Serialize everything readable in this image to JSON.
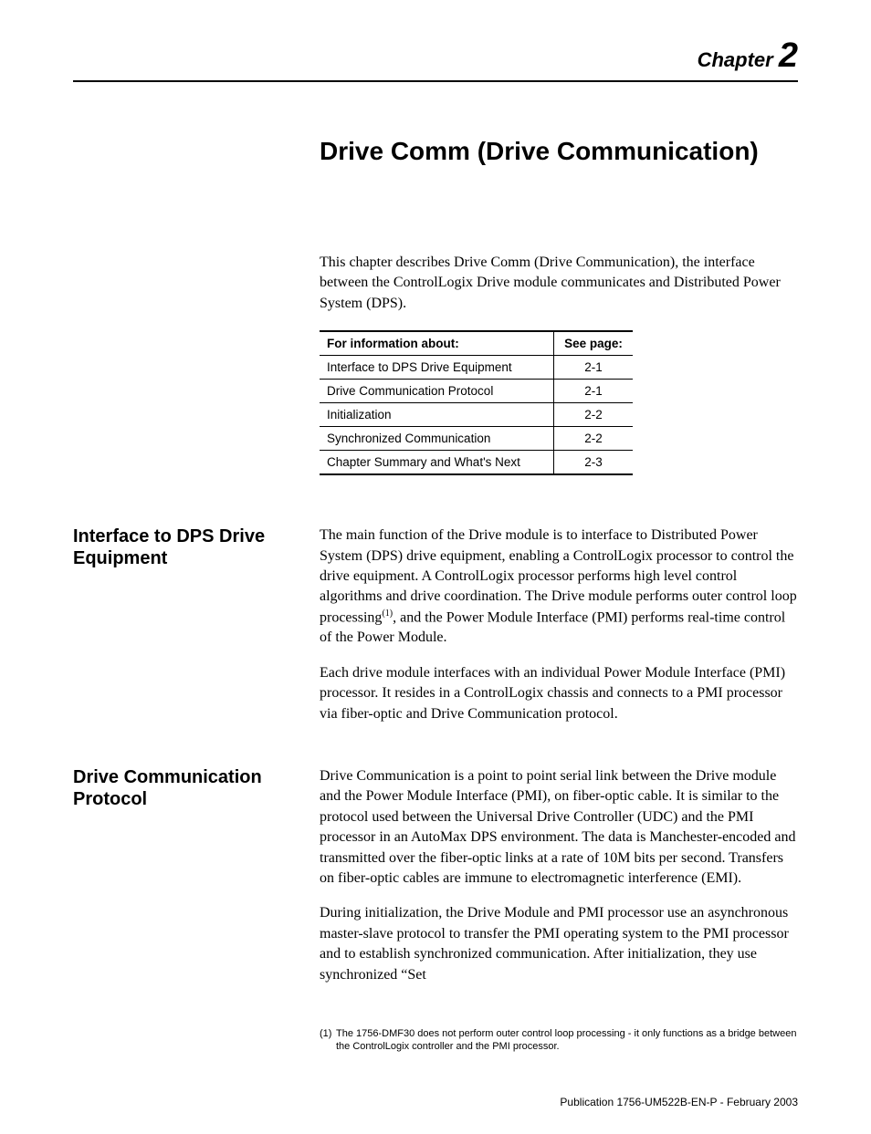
{
  "header": {
    "chapter_label": "Chapter",
    "chapter_number": "2"
  },
  "title": "Drive Comm (Drive Communication)",
  "intro": "This chapter describes Drive Comm (Drive Communication), the interface between the ControlLogix Drive module communicates and Distributed Power System (DPS).",
  "table": {
    "header_left": "For information about:",
    "header_right": "See page:",
    "rows": [
      {
        "topic": "Interface to DPS Drive Equipment",
        "page": "2-1"
      },
      {
        "topic": "Drive Communication Protocol",
        "page": "2-1"
      },
      {
        "topic": "Initialization",
        "page": "2-2"
      },
      {
        "topic": "Synchronized Communication",
        "page": "2-2"
      },
      {
        "topic": "Chapter Summary and What's Next",
        "page": "2-3"
      }
    ]
  },
  "sections": [
    {
      "heading": "Interface to DPS Drive Equipment",
      "paragraphs_html": [
        "The main function of the Drive module is to interface to Distributed Power System (DPS) drive equipment, enabling a ControlLogix processor to control the drive equipment. A ControlLogix processor performs high level control algorithms and drive coordination. The Drive module performs outer control loop processing<sup>(1)</sup>, and the Power Module Interface (PMI) performs real-time control of the Power Module.",
        "Each drive module interfaces with an individual Power Module Interface (PMI) processor. It resides in a ControlLogix chassis and connects to a PMI processor via fiber-optic and Drive Communication protocol."
      ]
    },
    {
      "heading": "Drive Communication Protocol",
      "paragraphs_html": [
        "Drive Communication is a point to point serial link between the Drive module and the Power Module Interface (PMI), on fiber-optic cable. It is similar to the protocol used between the Universal Drive Controller (UDC) and the PMI processor in an AutoMax DPS environment. The data is Manchester-encoded and transmitted over the fiber-optic links at a rate of 10M bits per second. Transfers on fiber-optic cables are immune to electromagnetic interference (EMI).",
        "During initialization, the Drive Module and PMI processor use an asynchronous master-slave protocol to transfer the PMI operating system to the PMI processor and to establish synchronized communication. After initialization, they use synchronized “Set"
      ]
    }
  ],
  "footnote": {
    "marker": "(1)",
    "text": "The 1756-DMF30 does not perform outer control loop processing - it only functions as a bridge between the ControlLogix controller and the PMI processor."
  },
  "publication": "Publication 1756-UM522B-EN-P - February 2003"
}
